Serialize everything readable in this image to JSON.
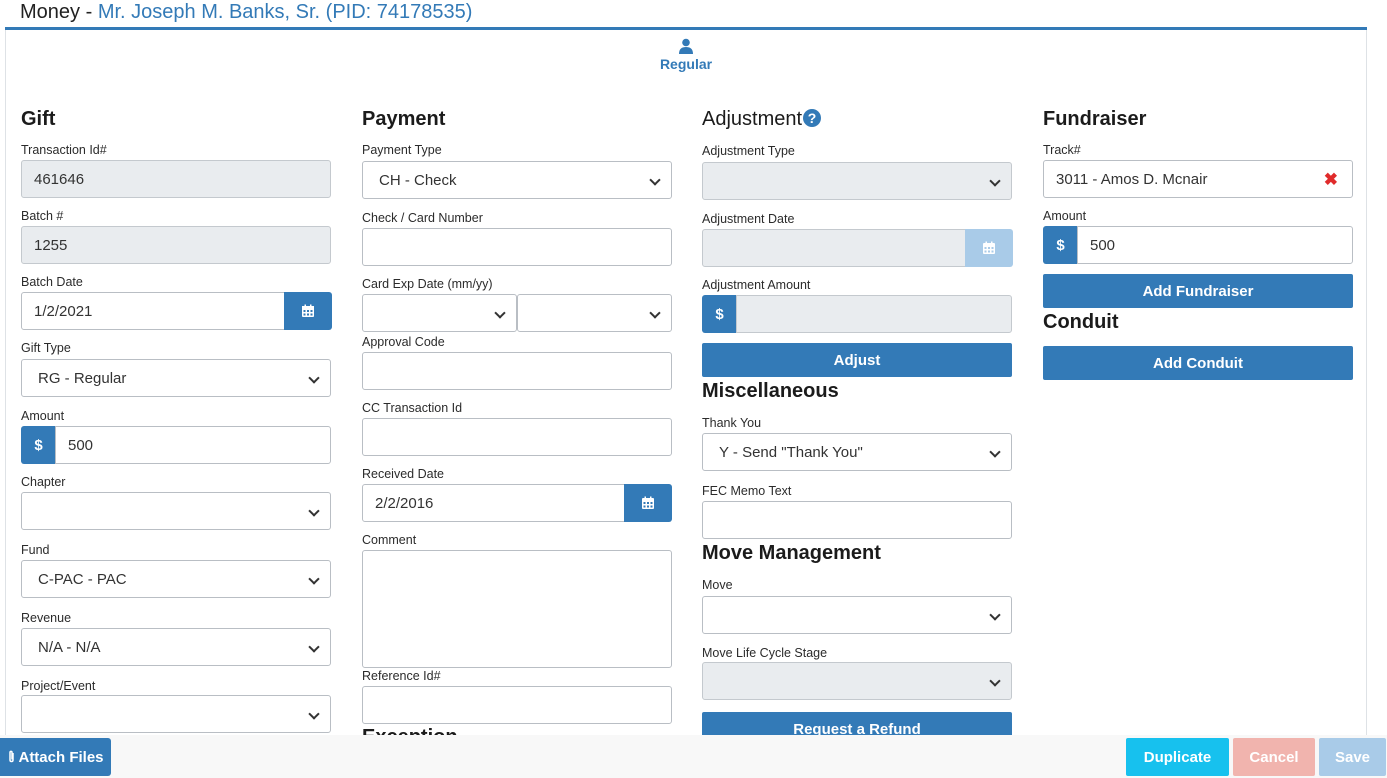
{
  "header": {
    "prefix": "Money - ",
    "person": "Mr. Joseph M. Banks, Sr. (PID: 74178535)"
  },
  "tabs": {
    "active_label": "Regular",
    "active_icon": "user-icon"
  },
  "gift": {
    "title": "Gift",
    "transaction_id": {
      "label": "Transaction Id#",
      "value": "461646"
    },
    "batch": {
      "label": "Batch #",
      "value": "1255"
    },
    "batch_date": {
      "label": "Batch Date",
      "value": "1/2/2021"
    },
    "gift_type": {
      "label": "Gift Type",
      "value": "RG - Regular"
    },
    "amount": {
      "label": "Amount",
      "currency": "$",
      "value": "500"
    },
    "chapter": {
      "label": "Chapter",
      "value": ""
    },
    "fund": {
      "label": "Fund",
      "value": "C-PAC - PAC"
    },
    "revenue": {
      "label": "Revenue",
      "value": "N/A - N/A"
    },
    "project_event": {
      "label": "Project/Event",
      "value": ""
    }
  },
  "payment": {
    "title": "Payment",
    "payment_type": {
      "label": "Payment Type",
      "value": "CH - Check"
    },
    "check_card_number": {
      "label": "Check / Card Number",
      "value": ""
    },
    "card_exp": {
      "label": "Card Exp Date (mm/yy)",
      "month": "",
      "year": ""
    },
    "approval_code": {
      "label": "Approval Code",
      "value": ""
    },
    "cc_transaction_id": {
      "label": "CC Transaction Id",
      "value": ""
    },
    "received_date": {
      "label": "Received Date",
      "value": "2/2/2016"
    },
    "comment": {
      "label": "Comment",
      "value": ""
    },
    "reference_id": {
      "label": "Reference Id#",
      "value": ""
    },
    "next_section_partial": "Exception"
  },
  "adjustment": {
    "title": "Adjustment",
    "help": "?",
    "adjustment_type": {
      "label": "Adjustment Type",
      "value": ""
    },
    "adjustment_date": {
      "label": "Adjustment Date",
      "value": ""
    },
    "adjustment_amount": {
      "label": "Adjustment Amount",
      "currency": "$",
      "value": ""
    },
    "adjust_button": "Adjust"
  },
  "miscellaneous": {
    "title": "Miscellaneous",
    "thank_you": {
      "label": "Thank You",
      "value": "Y - Send \"Thank You\""
    },
    "fec_memo": {
      "label": "FEC Memo Text",
      "value": ""
    }
  },
  "move_management": {
    "title": "Move Management",
    "move": {
      "label": "Move",
      "value": ""
    },
    "move_stage": {
      "label": "Move Life Cycle Stage",
      "value": ""
    },
    "refund_button": "Request a Refund"
  },
  "fundraiser": {
    "title": "Fundraiser",
    "track": {
      "label": "Track#",
      "value": "3011 - Amos D. Mcnair",
      "clear": "✖"
    },
    "amount": {
      "label": "Amount",
      "currency": "$",
      "value": "500"
    },
    "add_button": "Add Fundraiser"
  },
  "conduit": {
    "title": "Conduit",
    "add_button": "Add Conduit"
  },
  "footer": {
    "attach_files": "Attach Files",
    "duplicate": "Duplicate",
    "cancel": "Cancel",
    "save": "Save"
  },
  "colors": {
    "primary": "#337ab7",
    "duplicate": "#17c1ee",
    "cancel": "#f1b4ae",
    "save": "#a9cbe8"
  }
}
